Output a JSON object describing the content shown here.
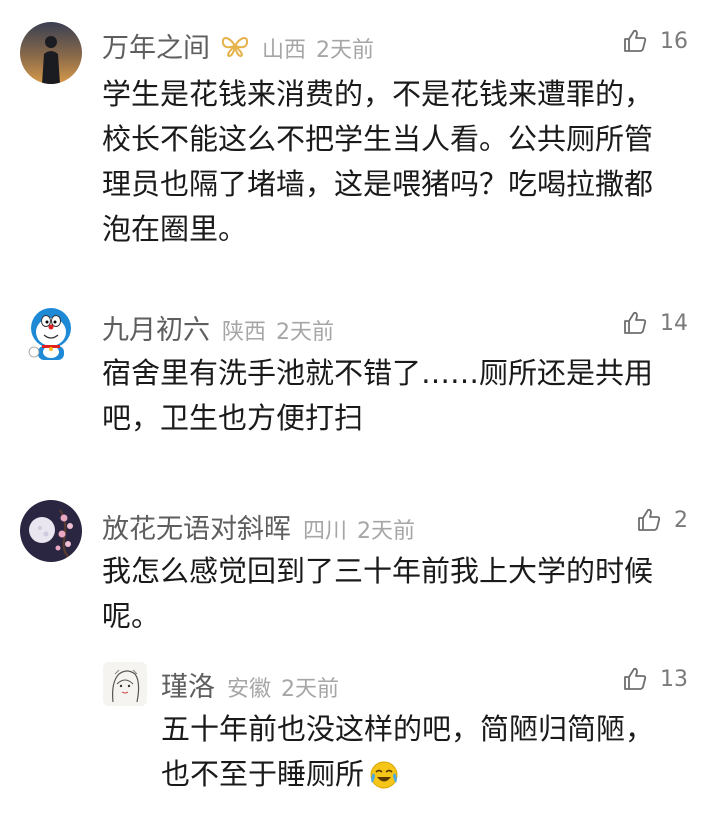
{
  "comments": [
    {
      "name": "万年之间",
      "location": "山西",
      "time": "2天前",
      "likes": "16",
      "avatar_icon": "sunset-silhouette-avatar",
      "badge_icon": "butterfly-badge-icon",
      "lines": [
        "学生是花钱来消费的，不是花钱来遭罪的，",
        "校长不能这么不把学生当人看。公共厕所管",
        "理员也隔了堵墙，这是喂猪吗？吃喝拉撒都",
        "泡在圈里。"
      ]
    },
    {
      "name": "九月初六",
      "location": "陕西",
      "time": "2天前",
      "likes": "14",
      "avatar_icon": "doraemon-avatar",
      "lines": [
        "宿舍里有洗手池就不错了……厕所还是共用",
        "吧，卫生也方便打扫"
      ]
    },
    {
      "name": "放花无语对斜晖",
      "location": "四川",
      "time": "2天前",
      "likes": "2",
      "avatar_icon": "night-moon-avatar",
      "lines": [
        "我怎么感觉回到了三十年前我上大学的时候",
        "呢。"
      ]
    }
  ],
  "reply": {
    "name": "瑾洛",
    "location": "安徽",
    "time": "2天前",
    "likes": "13",
    "avatar_icon": "sketch-girl-avatar",
    "emoji_icon": "crying-laughing-emoji",
    "lines": [
      "五十年前也没这样的吧，简陋归简陋，",
      "也不至于睡厕所"
    ]
  }
}
